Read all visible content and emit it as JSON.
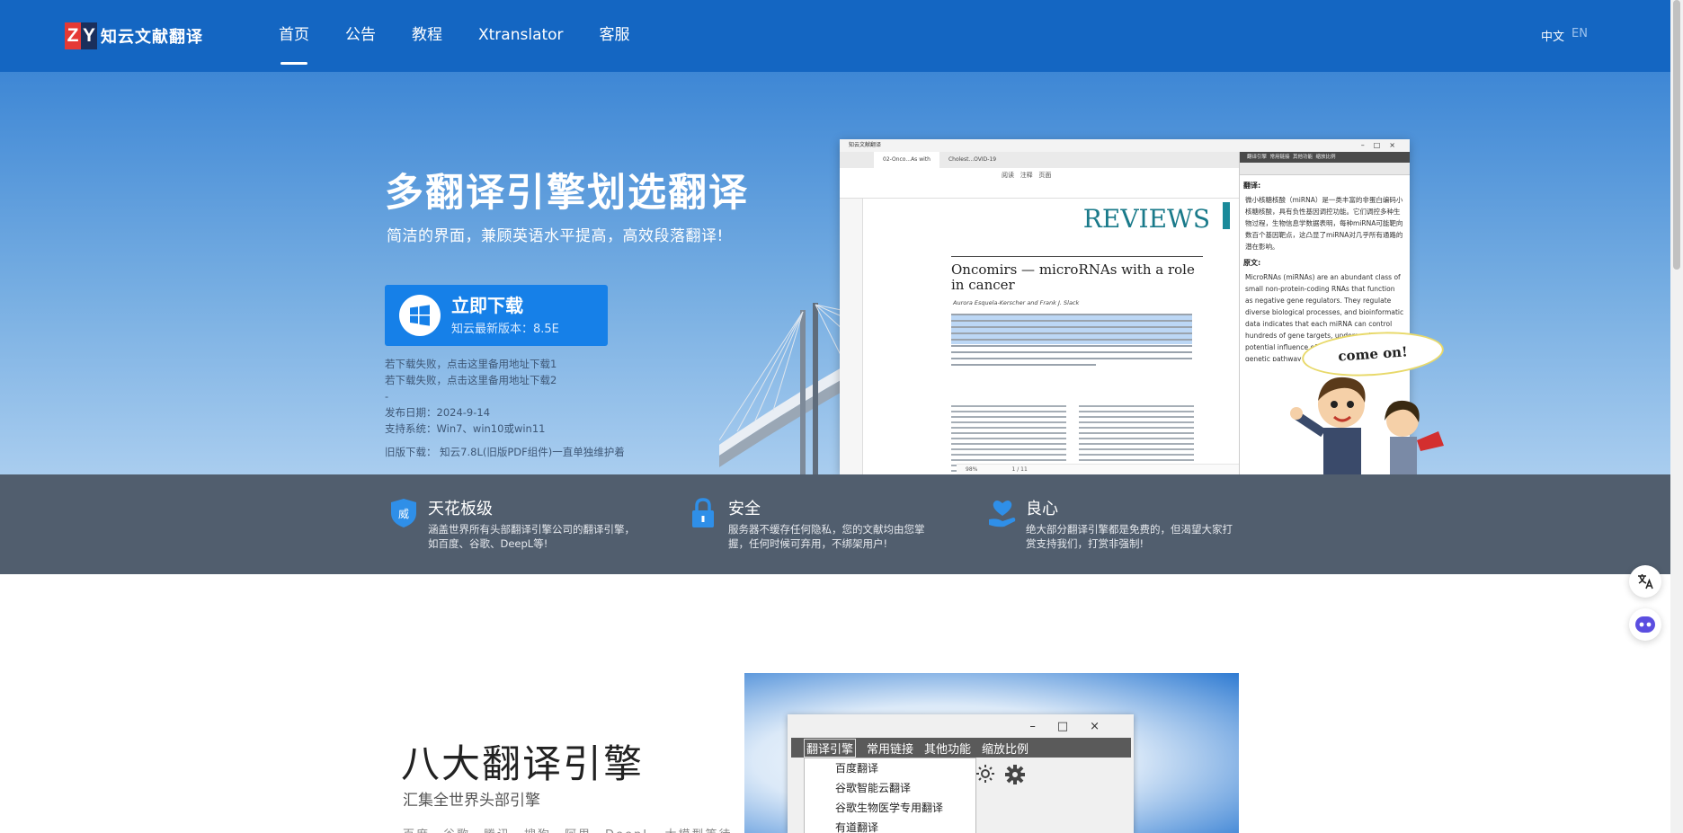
{
  "brand": {
    "mark_z": "Z",
    "mark_y": "Y",
    "name": "知云文献翻译"
  },
  "nav": {
    "items": [
      "首页",
      "公告",
      "教程",
      "Xtranslator",
      "客服"
    ],
    "active": "首页",
    "lang": {
      "zh": "中文",
      "en": "EN"
    }
  },
  "hero": {
    "title": "多翻译引擎划选翻译",
    "subtitle": "简洁的界面，兼顾英语水平提高，高效段落翻译!",
    "download": {
      "label": "立即下载",
      "version": "知云最新版本：8.5E"
    },
    "backup1": "若下载失败，点击这里备用地址下载1",
    "backup2": "若下载失败，点击这里备用地址下载2",
    "dash": "-",
    "release": "发布日期：2024-9-14",
    "os": "支持系统：Win7、win10或win11",
    "old_version": "旧版下载： 知云7.8L(旧版PDF组件)一直单独维护着"
  },
  "app_preview": {
    "window_title": "知云文献翻译",
    "tabs": [
      "02-Onco...As with",
      "Cholest...OVID-19"
    ],
    "menu": [
      "阅读",
      "注释",
      "页面"
    ],
    "file_menu": "文件",
    "journal": "REVIEWS",
    "paper_title": "Oncomirs — microRNAs with a role in cancer",
    "authors": "Aurora Esquela-Kerscher and Frank J. Slack",
    "zoom": "98%",
    "page": "1 / 11",
    "side_tabs": [
      "翻译引擎",
      "常用链接",
      "其他功能",
      "缩放比例"
    ],
    "translation_label": "翻译:",
    "translation_text": "微小核糖核酸（miRNA）是一类丰富的非蛋白编码小核糖核酸，具有负性基因调控功能。它们调控多种生物过程，生物信息学数据表明，每种miRNA可能靶向数百个基因靶点，这凸显了miRNA对几乎所有通路的潜在影响。",
    "original_label": "原文:",
    "original_text": "MicroRNAs (miRNAs) are an abundant class of small non-protein-coding RNAs that function as negative gene regulators. They regulate diverse biological processes, and bioinformatic data indicates that each miRNA can control hundreds of gene targets, underscoring the potential influence of miRNAs on almost every genetic pathway",
    "bubble": "come on!"
  },
  "features": [
    {
      "title": "天花板级",
      "desc": "涵盖世界所有头部翻译引擎公司的翻译引擎，如百度、谷歌、DeepL等!",
      "icon_char": "威"
    },
    {
      "title": "安全",
      "desc": "服务器不缓存任何隐私，您的文献均由您掌握，任何时候可弃用，不绑架用户!"
    },
    {
      "title": "良心",
      "desc": "绝大部分翻译引擎都是免费的，但渴望大家打赏支持我们，打赏非强制!"
    }
  ],
  "engines": {
    "title": "八大翻译引擎",
    "subtitle": "汇集全世界头部引擎",
    "names": "百度、谷歌、腾讯、搜狗、阿里、DeepL、大模型等待",
    "menubar": [
      "翻译引擎",
      "常用链接",
      "其他功能",
      "缩放比例"
    ],
    "dropdown": [
      "百度翻译",
      "谷歌智能云翻译",
      "谷歌生物医学专用翻译",
      "有道翻译"
    ]
  },
  "colors": {
    "nav": "#1466c2",
    "button": "#1680e8",
    "features": "#515e6e"
  },
  "icons": [
    "windows-icon",
    "shield-icon",
    "lock-icon",
    "heart-hand-icon",
    "translate-icon",
    "robot-icon",
    "gear-icon",
    "sun-icon"
  ]
}
